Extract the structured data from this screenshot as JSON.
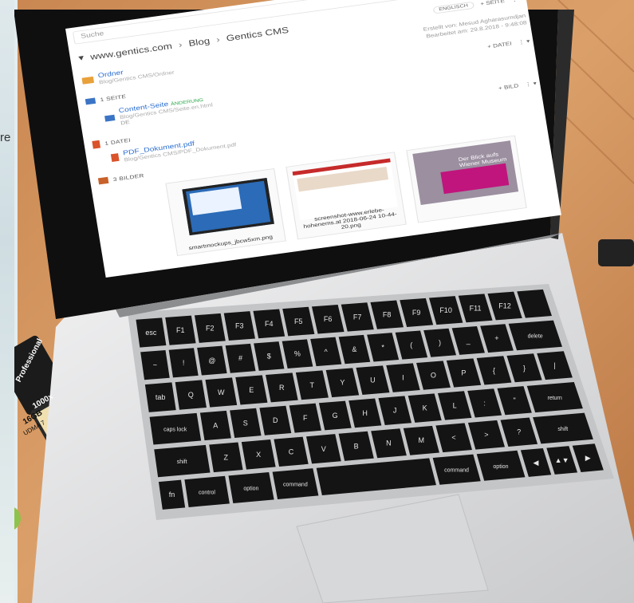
{
  "edge_text": "re",
  "screen": {
    "search_placeholder": "Suche",
    "breadcrumb": [
      "www.gentics.com",
      "Blog",
      "Gentics CMS"
    ],
    "toolbar": {
      "language": "ENGLISCH",
      "add_page": "+ SEITE"
    },
    "folder": {
      "name": "Ordner",
      "path": "Blog/Gentics CMS/Ordner",
      "created_by": "Erstellt von: Mesud Agharasumdjan",
      "edited": "Bearbeitet am: 29.8.2018 - 9:48:08"
    },
    "pages_section": {
      "label": "1 SEITE",
      "add": "+ DATEI"
    },
    "page_item": {
      "title": "Content-Seite",
      "status": "ÄNDERUNG",
      "path": "Blog/Gentics CMS/Seite.en.html",
      "lang": "DE"
    },
    "files_section": {
      "label": "1 DATEI",
      "add": "+ BILD"
    },
    "file_item": {
      "title": "PDF_Dokument.pdf",
      "path": "Blog/Gentics CMS/PDF_Dokument.pdf"
    },
    "images_section": {
      "label": "3 BILDER"
    },
    "images": [
      {
        "caption": "smartmockups_jbcw5xm.png"
      },
      {
        "caption": "screenshot-www.erlebe-hohenems.at 2018-06-24 10-44-20.png"
      },
      {
        "caption": "",
        "overlay": "Der Blick aufs Wiener Museum"
      }
    ]
  },
  "keyboard": {
    "rows": [
      [
        "esc",
        "F1",
        "F2",
        "F3",
        "F4",
        "F5",
        "F6",
        "F7",
        "F8",
        "F9",
        "F10",
        "F11",
        "F12",
        ""
      ],
      [
        "~",
        "!",
        "@",
        "#",
        "$",
        "%",
        "^",
        "&",
        "*",
        "(",
        ")",
        "_",
        "+",
        "delete"
      ],
      [
        "tab",
        "Q",
        "W",
        "E",
        "R",
        "T",
        "Y",
        "U",
        "I",
        "O",
        "P",
        "{",
        "}",
        "|"
      ],
      [
        "caps lock",
        "A",
        "S",
        "D",
        "F",
        "G",
        "H",
        "J",
        "K",
        "L",
        ":",
        "\"",
        "return"
      ],
      [
        "shift",
        "Z",
        "X",
        "C",
        "V",
        "B",
        "N",
        "M",
        "<",
        ">",
        "?",
        "shift"
      ],
      [
        "fn",
        "control",
        "option",
        "command",
        "",
        "command",
        "option",
        "◀",
        "▲▼",
        "▶"
      ]
    ]
  },
  "sd_card": {
    "brand": "Professional",
    "speed": "1000x",
    "capacity": "16GB",
    "class": "UDMA 7"
  },
  "colors": {
    "desk": "#d4915a",
    "laptop": "#dcdddf",
    "bezel": "#101010",
    "keys": "#141414",
    "accent_link": "#2c6fd1"
  }
}
